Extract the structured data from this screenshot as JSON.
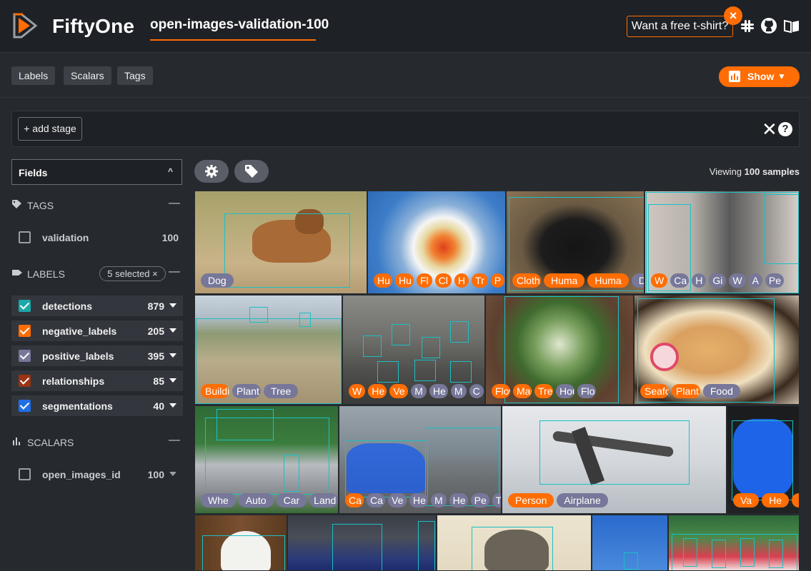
{
  "app": {
    "brand": "FiftyOne",
    "dataset_name": "open-images-validation-100"
  },
  "header": {
    "tshirt_label": "Want a free t-shirt?",
    "tshirt_close": "×",
    "icons": [
      "slack-icon",
      "github-icon",
      "docs-book-icon"
    ]
  },
  "tabs": [
    {
      "label": "Labels"
    },
    {
      "label": "Scalars"
    },
    {
      "label": "Tags"
    }
  ],
  "show_button": {
    "label": "Show",
    "icon": "bar-chart-icon"
  },
  "view_bar": {
    "add_stage_label": "+ add stage",
    "clear": "✕",
    "help": "?"
  },
  "sidebar": {
    "fields_dropdown": "Fields",
    "tags_section": {
      "title": "TAGS",
      "collapse": "—",
      "items": [
        {
          "name": "validation",
          "count": "100",
          "checked": false
        }
      ]
    },
    "labels_section": {
      "title": "LABELS",
      "selected_pill": "5 selected ×",
      "collapse": "—",
      "items": [
        {
          "name": "detections",
          "count": "879",
          "checked": true,
          "color": "#1ba8a8"
        },
        {
          "name": "negative_labels",
          "count": "205",
          "checked": true,
          "color": "#ff6d04"
        },
        {
          "name": "positive_labels",
          "count": "395",
          "checked": true,
          "color": "#777799"
        },
        {
          "name": "relationships",
          "count": "85",
          "checked": true,
          "color": "#9a3412"
        },
        {
          "name": "segmentations",
          "count": "40",
          "checked": true,
          "color": "#1e6fe8"
        }
      ]
    },
    "scalars_section": {
      "title": "SCALARS",
      "collapse": "—",
      "items": [
        {
          "name": "open_images_id",
          "count": "100",
          "checked": false
        }
      ]
    }
  },
  "grid_toolbar": {
    "viewing_prefix": "Viewing",
    "viewing_count": "100 samples",
    "icons": [
      "settings-gear-icon",
      "tag-icon"
    ]
  },
  "samples": [
    {
      "subject": "dog",
      "tags": [
        {
          "t": "Dog",
          "c": "p"
        }
      ]
    },
    {
      "subject": "weather-map",
      "tags": [
        {
          "t": "Hu",
          "c": "o"
        },
        {
          "t": "Hu",
          "c": "o"
        },
        {
          "t": "Fl",
          "c": "o"
        },
        {
          "t": "Cl",
          "c": "o"
        },
        {
          "t": "H",
          "c": "o"
        },
        {
          "t": "Tr",
          "c": "o"
        },
        {
          "t": "P",
          "c": "o"
        }
      ]
    },
    {
      "subject": "black-puppy",
      "tags": [
        {
          "t": "Cloth",
          "c": "o"
        },
        {
          "t": "Huma",
          "c": "o"
        },
        {
          "t": "Huma",
          "c": "o"
        },
        {
          "t": "Do",
          "c": "p"
        }
      ]
    },
    {
      "subject": "car-interior",
      "tags": [
        {
          "t": "W",
          "c": "o"
        },
        {
          "t": "Ca",
          "c": "p"
        },
        {
          "t": "H",
          "c": "p"
        },
        {
          "t": "Gi",
          "c": "p"
        },
        {
          "t": "W",
          "c": "p"
        },
        {
          "t": "A",
          "c": "p"
        },
        {
          "t": "Pe",
          "c": "p"
        }
      ]
    },
    {
      "subject": "fortress",
      "tags": [
        {
          "t": "Building",
          "c": "o"
        },
        {
          "t": "Plant",
          "c": "p"
        },
        {
          "t": "Tree",
          "c": "p"
        }
      ]
    },
    {
      "subject": "group-photo",
      "tags": [
        {
          "t": "W",
          "c": "o"
        },
        {
          "t": "He",
          "c": "o"
        },
        {
          "t": "Ve",
          "c": "o"
        },
        {
          "t": "M",
          "c": "p"
        },
        {
          "t": "He",
          "c": "p"
        },
        {
          "t": "M",
          "c": "p"
        },
        {
          "t": "C",
          "c": "p"
        }
      ]
    },
    {
      "subject": "succulent",
      "tags": [
        {
          "t": "Flow",
          "c": "o"
        },
        {
          "t": "Mar",
          "c": "o"
        },
        {
          "t": "Tre",
          "c": "o"
        },
        {
          "t": "Hou",
          "c": "p"
        },
        {
          "t": "Flo",
          "c": "p"
        }
      ]
    },
    {
      "subject": "noodle-soup",
      "tags": [
        {
          "t": "Seafood",
          "c": "o"
        },
        {
          "t": "Plant",
          "c": "o"
        },
        {
          "t": "Food",
          "c": "p"
        }
      ]
    },
    {
      "subject": "silver-car",
      "tags": [
        {
          "t": "Whe",
          "c": "p"
        },
        {
          "t": "Auto",
          "c": "p"
        },
        {
          "t": "Car",
          "c": "p"
        },
        {
          "t": "Land v",
          "c": "p"
        }
      ]
    },
    {
      "subject": "horse-carriage",
      "tags": [
        {
          "t": "Ca",
          "c": "o"
        },
        {
          "t": "Ca",
          "c": "p"
        },
        {
          "t": "Ve",
          "c": "p"
        },
        {
          "t": "He",
          "c": "p"
        },
        {
          "t": "M",
          "c": "p"
        },
        {
          "t": "He",
          "c": "p"
        },
        {
          "t": "Pe",
          "c": "p"
        },
        {
          "t": "T",
          "c": "p"
        }
      ]
    },
    {
      "subject": "airplane",
      "tags": [
        {
          "t": "Person",
          "c": "o"
        },
        {
          "t": "Airplane",
          "c": "p"
        }
      ]
    },
    {
      "subject": "blue-object",
      "tags": [
        {
          "t": "Va",
          "c": "o"
        },
        {
          "t": "He",
          "c": "o"
        },
        {
          "t": "He",
          "c": "o"
        }
      ]
    },
    {
      "subject": "egret",
      "tags": []
    },
    {
      "subject": "table-tennis",
      "tags": []
    },
    {
      "subject": "mammoth-sketch",
      "tags": []
    },
    {
      "subject": "crane-sky",
      "tags": []
    },
    {
      "subject": "crowd-event",
      "tags": []
    }
  ]
}
